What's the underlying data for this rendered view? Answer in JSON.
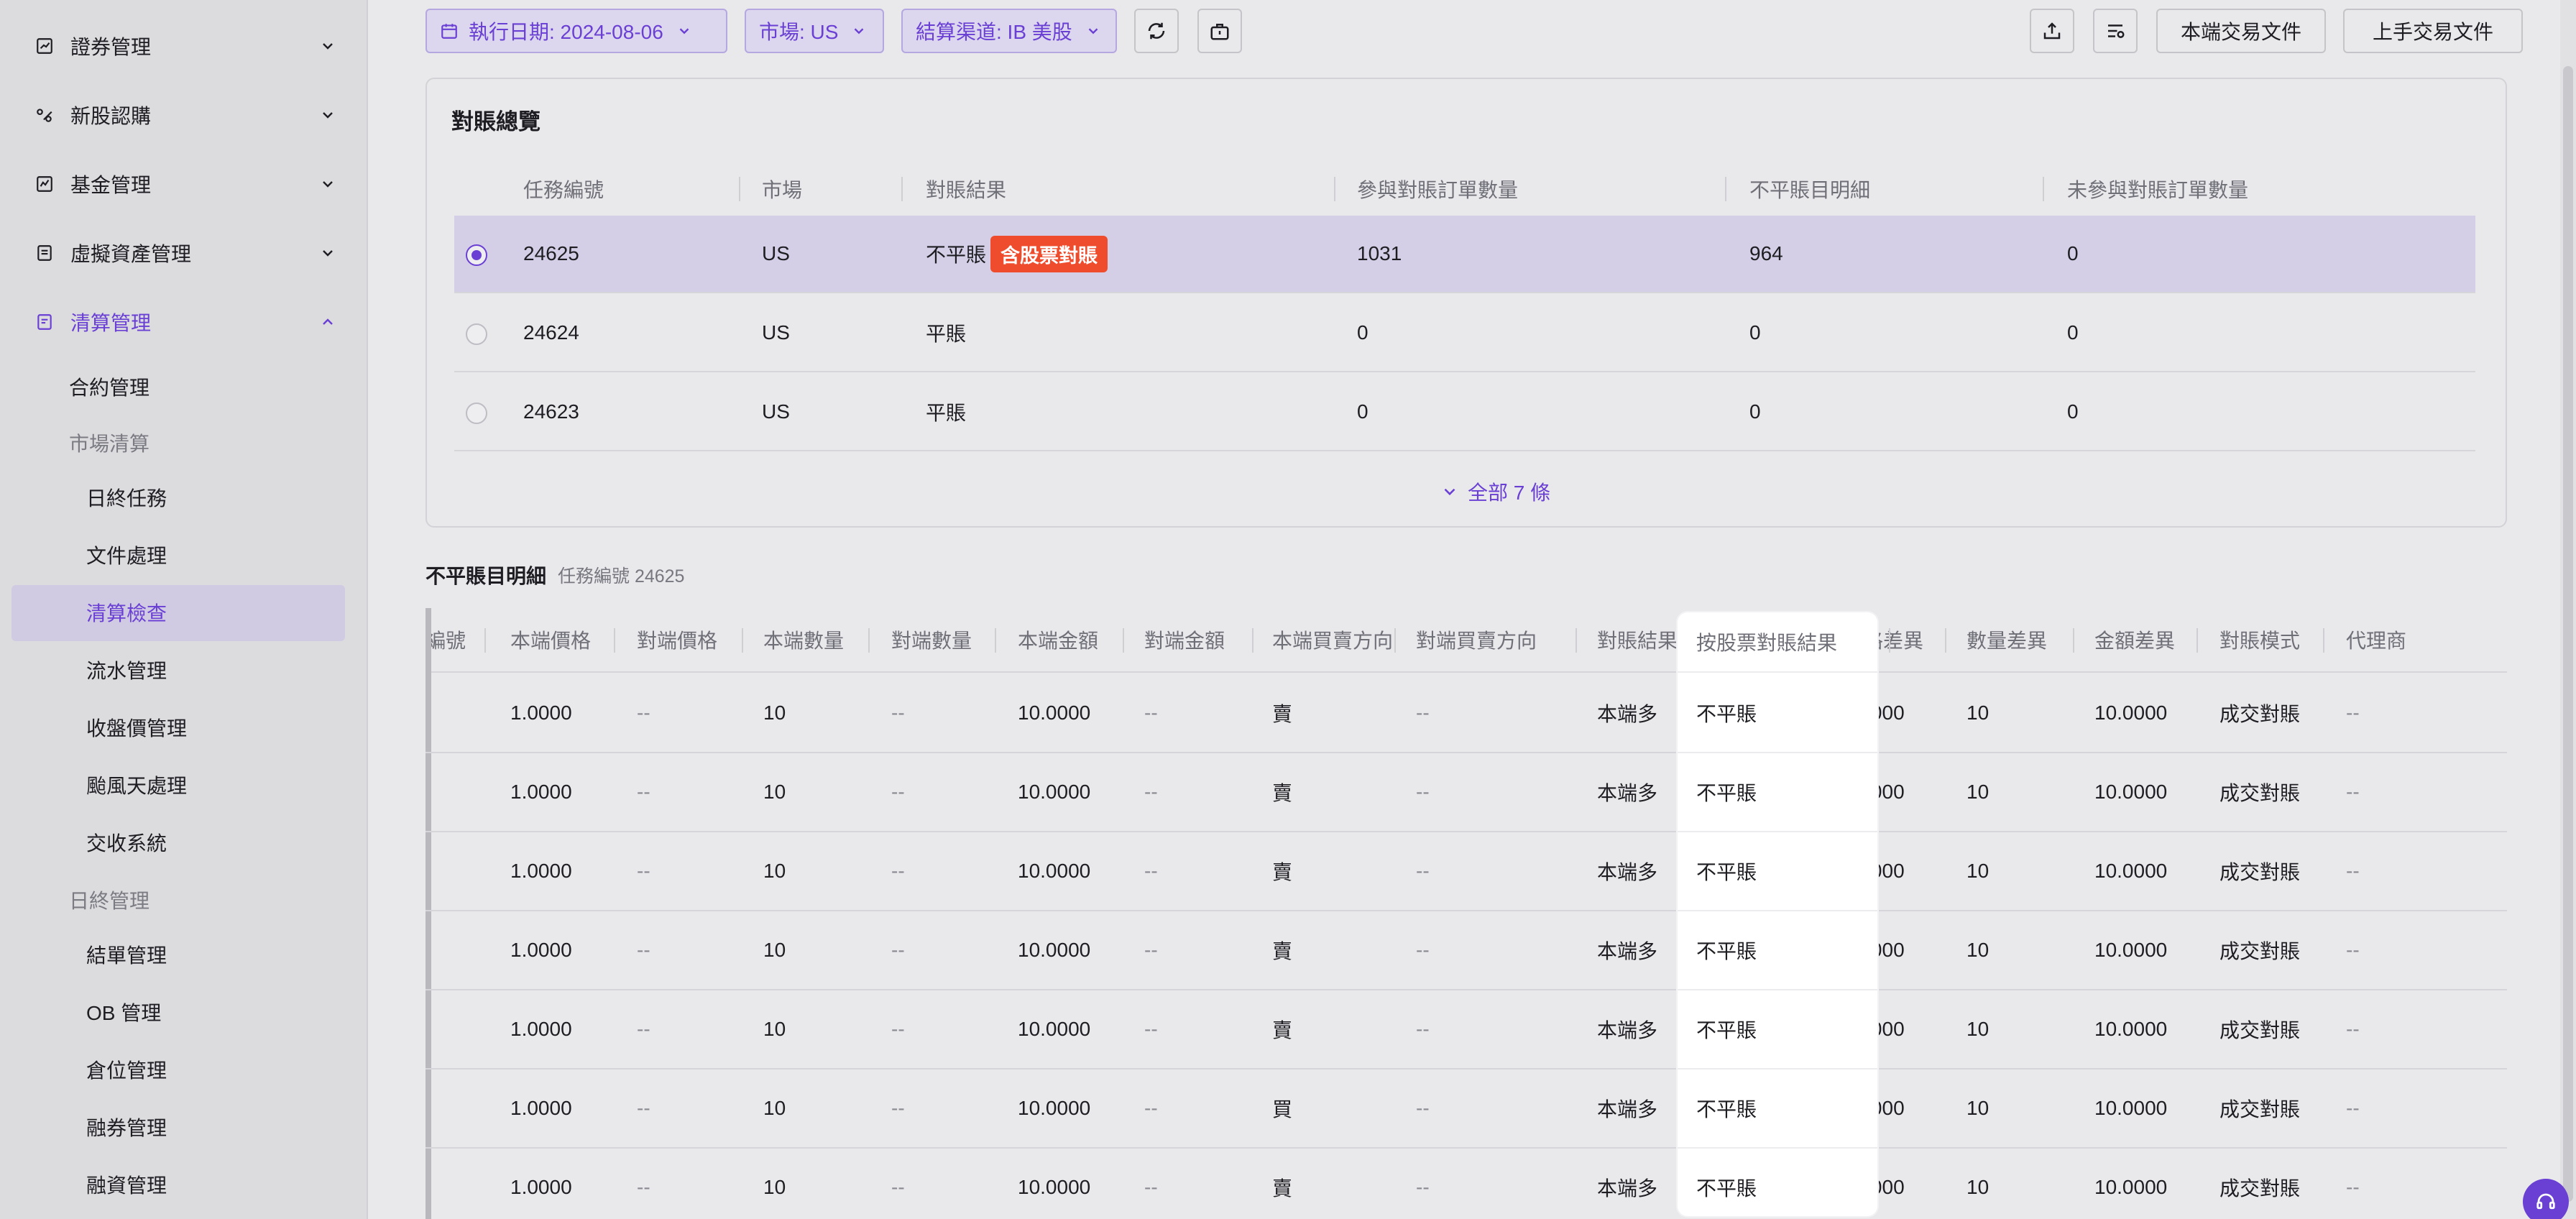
{
  "colors": {
    "accent": "#6a3fd4",
    "danger_tag": "#ee4c2c",
    "selected_row": "#d4cfe6"
  },
  "sidebar": {
    "groups": [
      {
        "label": "證券管理",
        "icon": "chart-icon",
        "expanded": false
      },
      {
        "label": "新股認購",
        "icon": "ipo-icon",
        "expanded": false
      },
      {
        "label": "基金管理",
        "icon": "fund-chart-icon",
        "expanded": false
      },
      {
        "label": "虛擬資產管理",
        "icon": "document-icon",
        "expanded": false
      },
      {
        "label": "清算管理",
        "icon": "ledger-icon",
        "expanded": true
      }
    ],
    "items": [
      {
        "label": "合約管理",
        "kind": "item"
      },
      {
        "label": "市場清算",
        "kind": "section"
      },
      {
        "label": "日終任務",
        "kind": "leaf"
      },
      {
        "label": "文件處理",
        "kind": "leaf"
      },
      {
        "label": "清算檢查",
        "kind": "leaf",
        "selected": true
      },
      {
        "label": "流水管理",
        "kind": "leaf"
      },
      {
        "label": "收盤價管理",
        "kind": "leaf"
      },
      {
        "label": "颱風天處理",
        "kind": "leaf"
      },
      {
        "label": "交收系統",
        "kind": "leaf"
      },
      {
        "label": "日終管理",
        "kind": "section"
      },
      {
        "label": "結單管理",
        "kind": "leaf"
      },
      {
        "label": "OB 管理",
        "kind": "leaf"
      },
      {
        "label": "倉位管理",
        "kind": "leaf"
      },
      {
        "label": "融券管理",
        "kind": "leaf"
      },
      {
        "label": "融資管理",
        "kind": "leaf"
      }
    ]
  },
  "toolbar": {
    "date_filter": "執行日期: 2024-08-06",
    "market_filter": "市場: US",
    "channel_filter": "結算渠道: IB 美股",
    "local_file_button": "本端交易文件",
    "upstream_file_button": "上手交易文件"
  },
  "overview": {
    "title": "對賬總覽",
    "columns": [
      "任務編號",
      "市場",
      "對賬結果",
      "參與對賬訂單數量",
      "不平賬目明細",
      "未參與對賬訂單數量"
    ],
    "rows": [
      {
        "task_id": "24625",
        "market": "US",
        "result": "不平賬",
        "tag": "含股票對賬",
        "count": "1031",
        "unbalanced": "964",
        "excluded": "0",
        "selected": true
      },
      {
        "task_id": "24624",
        "market": "US",
        "result": "平賬",
        "tag": "",
        "count": "0",
        "unbalanced": "0",
        "excluded": "0",
        "selected": false
      },
      {
        "task_id": "24623",
        "market": "US",
        "result": "平賬",
        "tag": "",
        "count": "0",
        "unbalanced": "0",
        "excluded": "0",
        "selected": false
      }
    ],
    "show_all": "全部 7 條"
  },
  "detail": {
    "title": "不平賬目明細",
    "subtitle": "任務編號 24625",
    "columns": [
      "編號",
      "本端價格",
      "對端價格",
      "本端數量",
      "對端數量",
      "本端金額",
      "對端金額",
      "本端買賣方向",
      "對端買賣方向",
      "對賬結果",
      "按股票對賬結果",
      "價格差異",
      "數量差異",
      "金額差異",
      "對賬模式",
      "代理商"
    ],
    "rows": [
      [
        "",
        "1.0000",
        "--",
        "10",
        "--",
        "10.0000",
        "--",
        "賣",
        "--",
        "本端多",
        "不平賬",
        "1.0000",
        "10",
        "10.0000",
        "成交對賬",
        "--"
      ],
      [
        "",
        "1.0000",
        "--",
        "10",
        "--",
        "10.0000",
        "--",
        "賣",
        "--",
        "本端多",
        "不平賬",
        "1.0000",
        "10",
        "10.0000",
        "成交對賬",
        "--"
      ],
      [
        "",
        "1.0000",
        "--",
        "10",
        "--",
        "10.0000",
        "--",
        "賣",
        "--",
        "本端多",
        "不平賬",
        "1.0000",
        "10",
        "10.0000",
        "成交對賬",
        "--"
      ],
      [
        "",
        "1.0000",
        "--",
        "10",
        "--",
        "10.0000",
        "--",
        "賣",
        "--",
        "本端多",
        "不平賬",
        "1.0000",
        "10",
        "10.0000",
        "成交對賬",
        "--"
      ],
      [
        "",
        "1.0000",
        "--",
        "10",
        "--",
        "10.0000",
        "--",
        "賣",
        "--",
        "本端多",
        "不平賬",
        "1.0000",
        "10",
        "10.0000",
        "成交對賬",
        "--"
      ],
      [
        "",
        "1.0000",
        "--",
        "10",
        "--",
        "10.0000",
        "--",
        "買",
        "--",
        "本端多",
        "不平賬",
        "1.0000",
        "10",
        "10.0000",
        "成交對賬",
        "--"
      ],
      [
        "",
        "1.0000",
        "--",
        "10",
        "--",
        "10.0000",
        "--",
        "賣",
        "--",
        "本端多",
        "不平賬",
        "1.0000",
        "10",
        "10.0000",
        "成交對賬",
        "--"
      ]
    ]
  }
}
